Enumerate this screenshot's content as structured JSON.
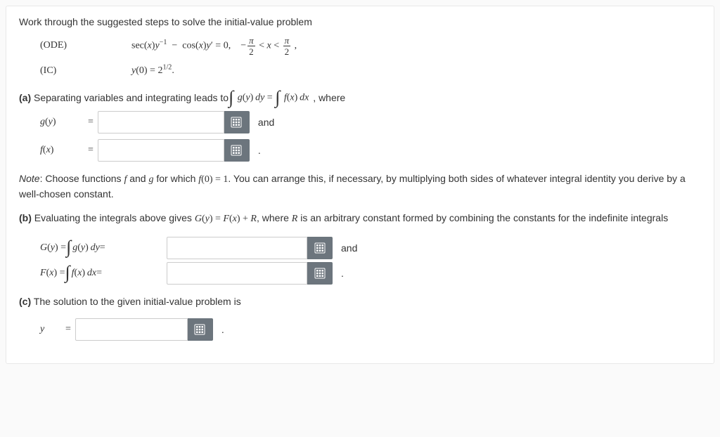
{
  "intro": "Work through the suggested steps to solve the initial-value problem",
  "ode": {
    "tag": "(ODE)",
    "expr_html": "sec(<span class='mi'>x</span>)<span class='mi'>y</span><sup>&minus;1</sup> &nbsp;&minus;&nbsp; cos(<span class='mi'>x</span>)<span class='mi'>y</span>&prime; = 0, &nbsp;&nbsp; &minus;<span class='frac'><span class='num'><span class='mi'>&pi;</span></span><span class='den'>2</span></span> &lt; <span class='mi'>x</span> &lt; <span class='frac'><span class='num'><span class='mi'>&pi;</span></span><span class='den'>2</span></span> ,"
  },
  "ic": {
    "tag": "(IC)",
    "expr_html": "<span class='mi'>y</span>(0) = 2<sup>1/2</sup>."
  },
  "partA": {
    "lead": "(a)",
    "text_before": " Separating variables and integrating leads to ",
    "integral_html": "<span class='int'>&#8747;</span> <span class='mi'>g</span>(<span class='mi'>y</span>)&thinsp;<span class='mi'>d</span><span class='mi'>y</span> = <span class='int'>&#8747;</span> <span class='mi'>f</span>(<span class='mi'>x</span>)&thinsp;<span class='mi'>d</span><span class='mi'>x</span>",
    "text_after": ", where"
  },
  "gy_label_html": "<span class='mi'>g</span><span class='rm'>(</span><span class='mi'>y</span><span class='rm'>)</span>",
  "fx_label_html": "<span class='mi'>f</span><span class='rm'>(</span><span class='mi'>x</span><span class='rm'>)</span>",
  "and": "and",
  "period": ".",
  "eq": "=",
  "note_html": "<i>Note</i>: Choose functions <span class='math'><span class='mi'>f</span></span> and <span class='math'><span class='mi'>g</span></span> for which <span class='math'><span class='mi'>f</span>(0) = 1</span>. You can arrange this, if necessary, by multiplying both sides of whatever integral identity you derive by a well-chosen constant.",
  "partB_html": "<b>(b)</b> Evaluating the integrals above gives <span class='math'><span class='mi'>G</span>(<span class='mi'>y</span>) = <span class='mi'>F</span>(<span class='mi'>x</span>) + <span class='mi'>R</span></span>, where <span class='math'><span class='mi'>R</span></span> is an arbitrary constant formed by combining the constants for the indefinite integrals",
  "Gy_pre_html": "<span class='mi'>G</span>(<span class='mi'>y</span>) = <span class='int'>&#8747;</span> <span class='mi'>g</span>(<span class='mi'>y</span>)&thinsp;<span class='mi'>d</span><span class='mi'>y</span> <span style='font-style:normal'>=</span>",
  "Fx_pre_html": "<span class='mi'>F</span>(<span class='mi'>x</span>) = <span class='int'>&#8747;</span> <span class='mi'>f</span>(<span class='mi'>x</span>)&thinsp;<span class='mi'>d</span><span class='mi'>x</span> <span style='font-style:normal'>=</span>",
  "partC": "(c) The solution to the given initial-value problem is",
  "y_label_html": "<span class='mi'>y</span>"
}
